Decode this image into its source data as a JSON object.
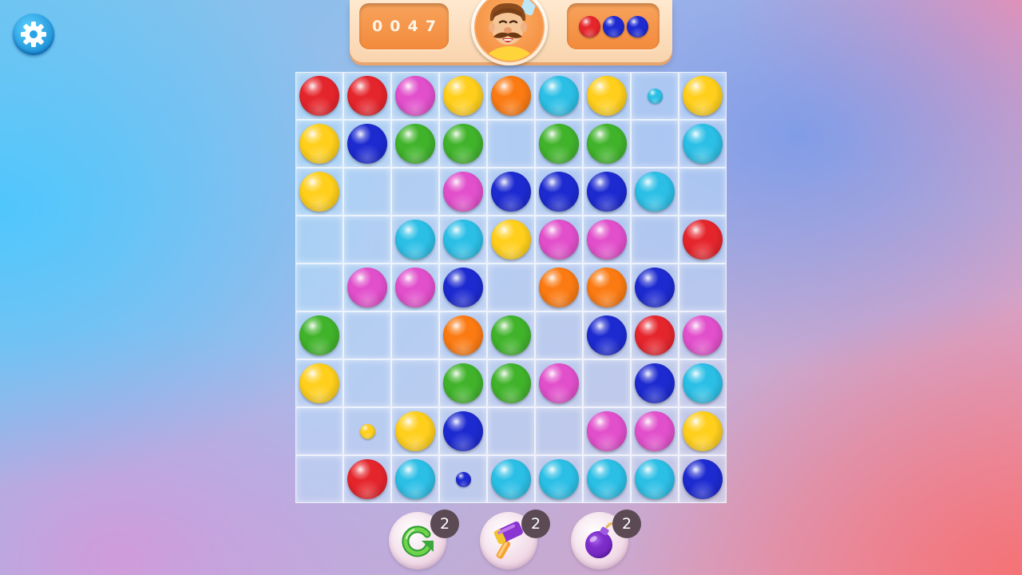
{
  "colors": {
    "red": "#e5252c",
    "pink": "#e24fcb",
    "yellow": "#ffcf1c",
    "orange": "#fb7a12",
    "cyan": "#2bbfe6",
    "blue": "#1d2ad0",
    "green": "#40b32a"
  },
  "header": {
    "score": "0047",
    "next_balls": [
      "red",
      "blue",
      "blue"
    ],
    "avatar_icon": "mustached-chef-avatar-icon"
  },
  "settings": {
    "icon": "gear-icon"
  },
  "board": {
    "rows": [
      [
        "red",
        "red",
        "pink",
        "yellow",
        "orange",
        "cyan",
        "yellow",
        "cyan-small",
        "yellow"
      ],
      [
        "yellow",
        "blue",
        "green",
        "green",
        null,
        "green",
        "green",
        null,
        "cyan"
      ],
      [
        "yellow",
        null,
        null,
        "pink",
        "blue",
        "blue",
        "blue",
        "cyan",
        null
      ],
      [
        null,
        null,
        "cyan",
        "cyan",
        "yellow",
        "pink",
        "pink",
        null,
        "red"
      ],
      [
        null,
        "pink",
        "pink",
        "blue",
        null,
        "orange",
        "orange",
        "blue",
        null
      ],
      [
        "green",
        null,
        null,
        "orange",
        "green",
        null,
        "blue",
        "red",
        "pink"
      ],
      [
        "yellow",
        null,
        null,
        "green",
        "green",
        "pink",
        null,
        "blue",
        "cyan"
      ],
      [
        null,
        "yellow-small",
        "yellow",
        "blue",
        null,
        null,
        "pink",
        "pink",
        "yellow"
      ],
      [
        null,
        "red",
        "cyan",
        "blue-small",
        "cyan",
        "cyan",
        "cyan",
        "cyan",
        "blue"
      ]
    ]
  },
  "boosters": [
    {
      "name": "refresh-booster",
      "icon": "refresh-arrow-icon",
      "count": "2"
    },
    {
      "name": "hammer-booster",
      "icon": "hammer-icon",
      "count": "2"
    },
    {
      "name": "bomb-booster",
      "icon": "bomb-icon",
      "count": "2"
    }
  ]
}
